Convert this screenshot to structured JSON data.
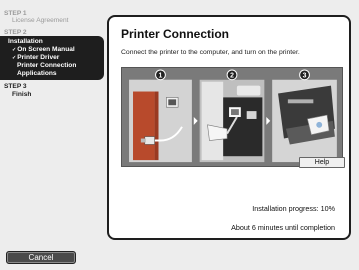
{
  "sidebar": {
    "step1_label": "STEP 1",
    "step1_item": "License Agreement",
    "step2_label": "STEP 2",
    "active_title": "Installation",
    "active_items": [
      "On Screen Manual",
      "Printer Driver"
    ],
    "active_sub_items": [
      "Printer Connection",
      "Applications"
    ],
    "step3_label": "STEP 3",
    "step3_item": "Finish"
  },
  "panel": {
    "title": "Printer Connection",
    "description": "Connect the printer to the computer, and turn on the printer.",
    "illustration_steps": [
      "1",
      "2",
      "3"
    ],
    "help_label": "Help",
    "progress_text": "Installation progress: 10%",
    "time_text": "About 6 minutes until completion"
  },
  "progress": {
    "percent": 10
  },
  "footer": {
    "cancel_label": "Cancel"
  },
  "colors": {
    "dark": "#1e1e1e",
    "panel": "#ffffff",
    "background": "#ededed"
  }
}
